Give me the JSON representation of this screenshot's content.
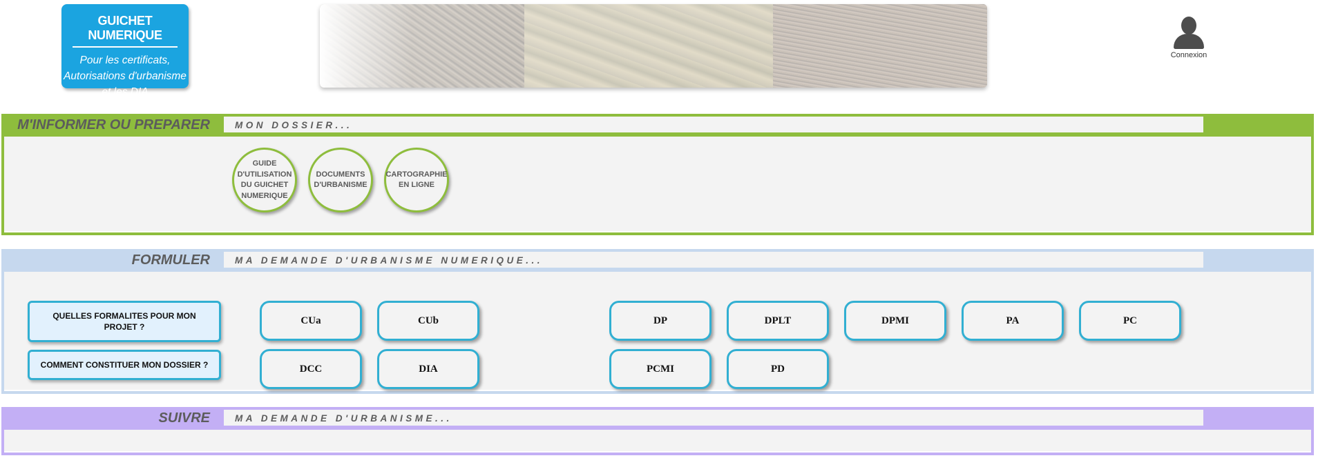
{
  "header": {
    "logo": {
      "title": "GUICHET NUMERIQUE",
      "subtitle_lines": [
        "Pour les certificats,",
        "Autorisations d'urbanisme",
        "et les DIA"
      ]
    },
    "login": {
      "label": "Connexion",
      "icon": "user-icon"
    }
  },
  "sections": {
    "inform": {
      "title": "M'INFORMER OU PREPARER",
      "subtitle": "MON DOSSIER...",
      "color": "#8ebd3d",
      "items": [
        {
          "label_lines": [
            "GUIDE",
            "D'UTILISATION",
            "DU GUICHET",
            "NUMERIQUE"
          ]
        },
        {
          "label_lines": [
            "DOCUMENTS",
            "D'URBANISME"
          ]
        },
        {
          "label_lines": [
            "CARTOGRAPHIE",
            "EN LIGNE"
          ]
        }
      ]
    },
    "formuler": {
      "title": "FORMULER",
      "subtitle": "MA DEMANDE D'URBANISME NUMERIQUE...",
      "color": "#c6d8ee",
      "help_buttons": [
        "QUELLES FORMALITES POUR MON PROJET ?",
        "COMMENT CONSTITUER MON DOSSIER ?"
      ],
      "forms": {
        "row1": [
          "CUa",
          "CUb",
          "DP",
          "DPLT",
          "DPMI",
          "PA",
          "PC"
        ],
        "row2": [
          "DCC",
          "DIA",
          "PCMI",
          "PD"
        ]
      }
    },
    "suivre": {
      "title": "SUIVRE",
      "subtitle": "MA DEMANDE D'URBANISME...",
      "color": "#c3aff5"
    }
  }
}
